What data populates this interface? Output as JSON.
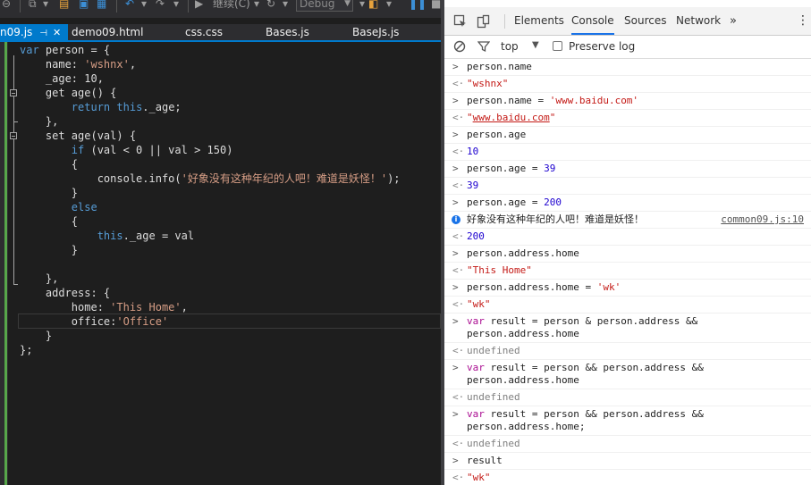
{
  "editor": {
    "toolbar": {
      "continue_label": "继续(C)",
      "configuration": "Debug"
    },
    "tabs": [
      {
        "label": "n09.js",
        "pin": "⊣",
        "close": "✕"
      },
      {
        "label": "demo09.html"
      },
      {
        "label": "css.css"
      },
      {
        "label": "Bases.js"
      },
      {
        "label": "BaseJs.js"
      }
    ]
  },
  "devtools": {
    "tabs": {
      "elements": "Elements",
      "console": "Console",
      "sources": "Sources",
      "network": "Network",
      "more": "»"
    },
    "console_bar": {
      "context": "top",
      "preserve_log": "Preserve log"
    },
    "info_source": "common09.js:10",
    "info_message": "好象没有这种年纪的人吧！难道是妖怪！"
  },
  "colors": {
    "editor_bg": "#1e1e1e",
    "keyword": "#569cd6",
    "string": "#d69d85",
    "accent_blue": "#007acc",
    "change_bar_green": "#57a64a",
    "console_string": "#c41a16",
    "console_number": "#1c00cf"
  }
}
